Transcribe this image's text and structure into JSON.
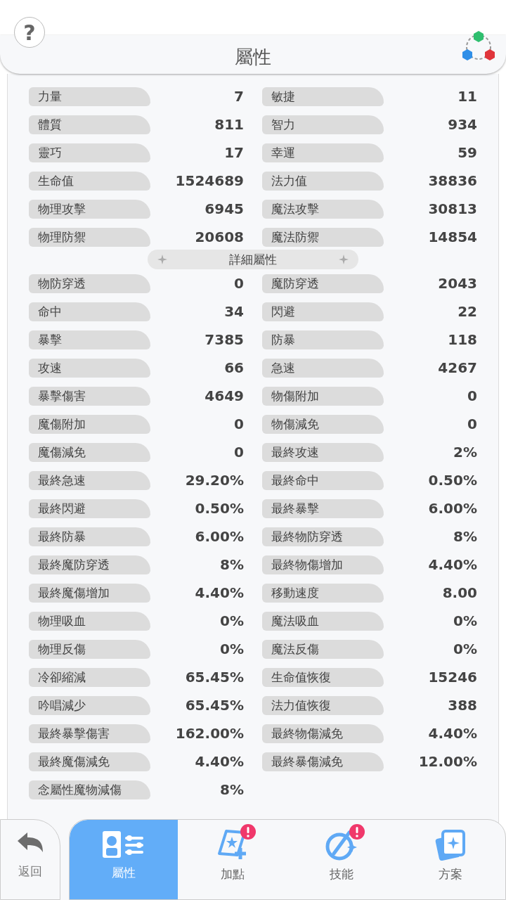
{
  "header": {
    "title": "屬性",
    "help": "?"
  },
  "basic": [
    {
      "label": "力量",
      "value": "7"
    },
    {
      "label": "敏捷",
      "value": "11"
    },
    {
      "label": "體質",
      "value": "811"
    },
    {
      "label": "智力",
      "value": "934"
    },
    {
      "label": "靈巧",
      "value": "17"
    },
    {
      "label": "幸運",
      "value": "59"
    },
    {
      "label": "生命值",
      "value": "1524689"
    },
    {
      "label": "法力值",
      "value": "38836"
    },
    {
      "label": "物理攻擊",
      "value": "6945"
    },
    {
      "label": "魔法攻擊",
      "value": "30813"
    },
    {
      "label": "物理防禦",
      "value": "20608"
    },
    {
      "label": "魔法防禦",
      "value": "14854"
    }
  ],
  "detail_title": "詳細屬性",
  "detail": [
    {
      "label": "物防穿透",
      "value": "0"
    },
    {
      "label": "魔防穿透",
      "value": "2043"
    },
    {
      "label": "命中",
      "value": "34"
    },
    {
      "label": "閃避",
      "value": "22"
    },
    {
      "label": "暴擊",
      "value": "7385"
    },
    {
      "label": "防暴",
      "value": "118"
    },
    {
      "label": "攻速",
      "value": "66"
    },
    {
      "label": "急速",
      "value": "4267"
    },
    {
      "label": "暴擊傷害",
      "value": "4649"
    },
    {
      "label": "物傷附加",
      "value": "0"
    },
    {
      "label": "魔傷附加",
      "value": "0"
    },
    {
      "label": "物傷減免",
      "value": "0"
    },
    {
      "label": "魔傷減免",
      "value": "0"
    },
    {
      "label": "最終攻速",
      "value": "2%"
    },
    {
      "label": "最終急速",
      "value": "29.20%"
    },
    {
      "label": "最終命中",
      "value": "0.50%"
    },
    {
      "label": "最終閃避",
      "value": "0.50%"
    },
    {
      "label": "最終暴擊",
      "value": "6.00%"
    },
    {
      "label": "最終防暴",
      "value": "6.00%"
    },
    {
      "label": "最終物防穿透",
      "value": "8%"
    },
    {
      "label": "最終魔防穿透",
      "value": "8%"
    },
    {
      "label": "最終物傷增加",
      "value": "4.40%"
    },
    {
      "label": "最終魔傷增加",
      "value": "4.40%"
    },
    {
      "label": "移動速度",
      "value": "8.00"
    },
    {
      "label": "物理吸血",
      "value": "0%"
    },
    {
      "label": "魔法吸血",
      "value": "0%"
    },
    {
      "label": "物理反傷",
      "value": "0%"
    },
    {
      "label": "魔法反傷",
      "value": "0%"
    },
    {
      "label": "冷卻縮減",
      "value": "65.45%"
    },
    {
      "label": "生命值恢復",
      "value": "15246"
    },
    {
      "label": "吟唱減少",
      "value": "65.45%"
    },
    {
      "label": "法力值恢復",
      "value": "388"
    },
    {
      "label": "最終暴擊傷害",
      "value": "162.00%"
    },
    {
      "label": "最終物傷減免",
      "value": "4.40%"
    },
    {
      "label": "最終魔傷減免",
      "value": "4.40%"
    },
    {
      "label": "最終暴傷減免",
      "value": "12.00%"
    },
    {
      "label": "念屬性魔物減傷",
      "value": "8%"
    }
  ],
  "back": {
    "label": "返回"
  },
  "tabs": [
    {
      "label": "屬性",
      "kind": "attributes",
      "selected": true,
      "alert": false
    },
    {
      "label": "加點",
      "kind": "points",
      "selected": false,
      "alert": true
    },
    {
      "label": "技能",
      "kind": "skills",
      "selected": false,
      "alert": true
    },
    {
      "label": "方案",
      "kind": "plans",
      "selected": false,
      "alert": false
    }
  ]
}
